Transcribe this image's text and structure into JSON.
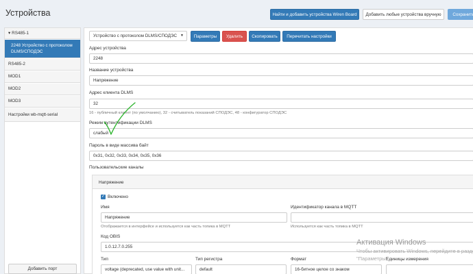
{
  "header": {
    "title": "Устройства",
    "find_button": "Найти и добавить устройства Wiren Board",
    "add_manual_button": "Добавить любые устройства вручную",
    "save_button": "Сохранить"
  },
  "sidebar": {
    "items": [
      {
        "label": "RS485-1",
        "chevron": "▾"
      },
      {
        "label": "2248 Устройство с протоколом DLMS/СПОДЭС"
      },
      {
        "label": "RS485-2"
      },
      {
        "label": "MOD1"
      },
      {
        "label": "MOD2"
      },
      {
        "label": "MOD3"
      },
      {
        "label": "Настройки wb-mqtt-serial"
      }
    ],
    "add_port_button": "Добавить порт"
  },
  "toolbar": {
    "device_type_value": "Устройство с протоколом DLMS/СПОДЭС",
    "params_button": "Параметры",
    "delete_button": "Удалить",
    "copy_button": "Скопировать",
    "reread_button": "Перечитать настройки"
  },
  "form": {
    "address_label": "Адрес устройства",
    "address_value": "2248",
    "name_label": "Название устройства",
    "name_value": "Напряжение",
    "client_address_label": "Адрес клиента DLMS",
    "client_address_value": "32",
    "client_address_help": "16 - публичный клиент (по умолчанию), 32 - считыватель показаний СПОДЭС, 48 - конфигуратор СПОДЭС",
    "auth_mode_label": "Режим аутентификации DLMS",
    "auth_mode_value": "слабый",
    "password_label": "Пароль в виде массива байт",
    "password_value": "0x31, 0x32, 0x33, 0x34, 0x35, 0x36",
    "channels_label": "Пользовательские каналы"
  },
  "channel": {
    "panel_title": "Напряжение",
    "enabled_label": "Включено",
    "name_label": "Имя",
    "name_value": "Напряжение",
    "name_help": "Отображается в интерфейсе и используется как часть топика в MQTT",
    "mqtt_id_label": "Идентификатор канала в MQTT",
    "mqtt_id_value": "",
    "mqtt_id_help": "Используется как часть топика в MQTT",
    "obis_label": "Код OBIS",
    "obis_value": "1.0.12.7.0.255",
    "type_label": "Тип",
    "type_value": "voltage (deprecated, use value with unit...",
    "register_type_label": "Тип регистра",
    "register_type_value": "default",
    "format_label": "Формат",
    "format_value": "16-битное целое со знаком",
    "units_label": "Единицы измерения"
  },
  "watermark": {
    "title": "Активация Windows",
    "line1": "Чтобы активировать Windows, перейдите в раздел",
    "line2": "\"Параметры\"."
  },
  "colors": {
    "primary": "#337ab7",
    "danger": "#d9534f",
    "annotation_green": "#2fb52f"
  }
}
